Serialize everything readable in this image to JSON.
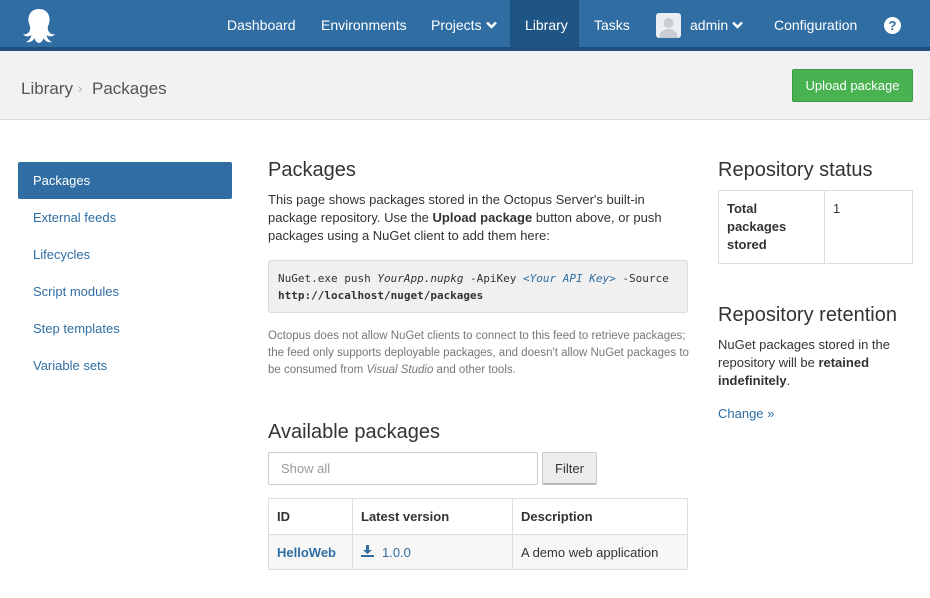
{
  "nav": {
    "items": [
      {
        "label": "Dashboard"
      },
      {
        "label": "Environments"
      },
      {
        "label": "Projects"
      },
      {
        "label": "Library"
      },
      {
        "label": "Tasks"
      }
    ],
    "user": "admin",
    "configuration": "Configuration",
    "help": "?"
  },
  "breadcrumb": {
    "parent": "Library",
    "separator": "›",
    "current": "Packages"
  },
  "header": {
    "upload_label": "Upload package"
  },
  "sidebar": {
    "items": [
      {
        "label": "Packages"
      },
      {
        "label": "External feeds"
      },
      {
        "label": "Lifecycles"
      },
      {
        "label": "Script modules"
      },
      {
        "label": "Step templates"
      },
      {
        "label": "Variable sets"
      }
    ]
  },
  "main": {
    "title": "Packages",
    "intro_1": "This page shows packages stored in the Octopus Server's built-in package repository. Use the ",
    "intro_bold": "Upload package",
    "intro_2": " button above, or push packages using a NuGet client to add them here:",
    "code": {
      "cmd": "NuGet.exe push ",
      "app": "YourApp.nupkg",
      "apikey_flag": " -ApiKey ",
      "key": "<Your API Key>",
      "source_flag": " -Source",
      "url": "http://localhost/nuget/packages"
    },
    "note_1": "Octopus does not allow NuGet clients to connect to this feed to retrieve packages; the feed only supports deployable packages, and doesn't allow NuGet packages to be consumed from ",
    "note_em": "Visual Studio",
    "note_2": " and other tools.",
    "available_title": "Available packages",
    "filter": {
      "placeholder": "Show all",
      "value": "",
      "button": "Filter"
    },
    "table": {
      "headers": [
        "ID",
        "Latest version",
        "Description"
      ],
      "rows": [
        {
          "id": "HelloWeb",
          "version": "1.0.0",
          "description": "A demo web application"
        }
      ]
    }
  },
  "status": {
    "title": "Repository status",
    "label": "Total packages stored",
    "value": "1"
  },
  "retention": {
    "title": "Repository retention",
    "text_1": "NuGet packages stored in the repository will be ",
    "text_bold": "retained indefinitely",
    "text_2": ".",
    "change": "Change »"
  },
  "colors": {
    "nav_bg": "#2f6da3",
    "nav_active": "#1f5585",
    "accent_green": "#48b350",
    "link": "#2f6da3"
  },
  "icons": [
    "octopus-logo",
    "chevron-down-icon",
    "avatar",
    "help-icon",
    "download-icon"
  ]
}
